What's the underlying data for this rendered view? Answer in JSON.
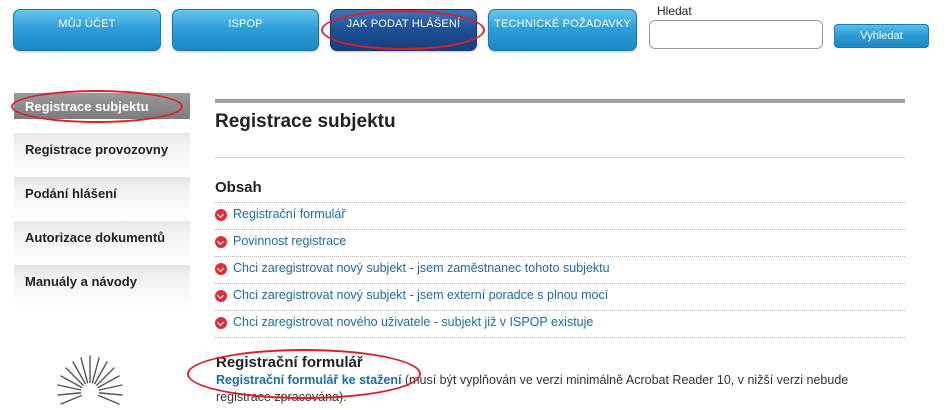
{
  "nav": {
    "tabs": [
      {
        "label": "MŮJ ÚČET"
      },
      {
        "label": "ISPOP"
      },
      {
        "label": "JAK PODAT HLÁŠENÍ"
      },
      {
        "label": "TECHNICKÉ POŽADAVKY"
      }
    ],
    "active_tab": "JAK PODAT HLÁŠENÍ"
  },
  "search": {
    "label": "Hledat",
    "value": "",
    "button_label": "Vyhledat"
  },
  "sidebar": {
    "items": [
      {
        "label": "Registrace subjektu"
      },
      {
        "label": "Registrace provozovny"
      },
      {
        "label": "Podání hlášení"
      },
      {
        "label": "Autorizace dokumentů"
      },
      {
        "label": "Manuály a návody"
      }
    ],
    "active_item": "Registrace subjektu"
  },
  "main": {
    "title": "Registrace subjektu",
    "contents_heading": "Obsah",
    "toc": [
      {
        "label": "Registrační formulář"
      },
      {
        "label": "Povinnost registrace"
      },
      {
        "label": "Chci zaregistrovat nový subjekt - jsem zaměstnanec tohoto subjektu"
      },
      {
        "label": "Chci zaregistrovat nový subjekt - jsem externí poradce s plnou mocí"
      },
      {
        "label": "Chci zaregistrovat nového uživatele - subjekt již v ISPOP existuje"
      }
    ],
    "form_section": {
      "heading": "Registrační formulář",
      "link_label": "Registrační formulář ke stažení",
      "text_after_link": " (musí být vyplňován ve verzi minimálně Acrobat Reader 10, v nižší verzi nebude",
      "text_line2": "registrace zpracována)."
    }
  },
  "colors": {
    "tab_blue": "#2e9fd9",
    "tab_active": "#1e4f96",
    "link": "#1f6aa8",
    "bullet_red": "#d9303b",
    "annotation_red": "#d9202a",
    "sidebar_active": "#7c7c7c"
  },
  "icons": {
    "toc_bullet": "chevron-down-circle-icon",
    "logo": "radial-logo-icon"
  }
}
